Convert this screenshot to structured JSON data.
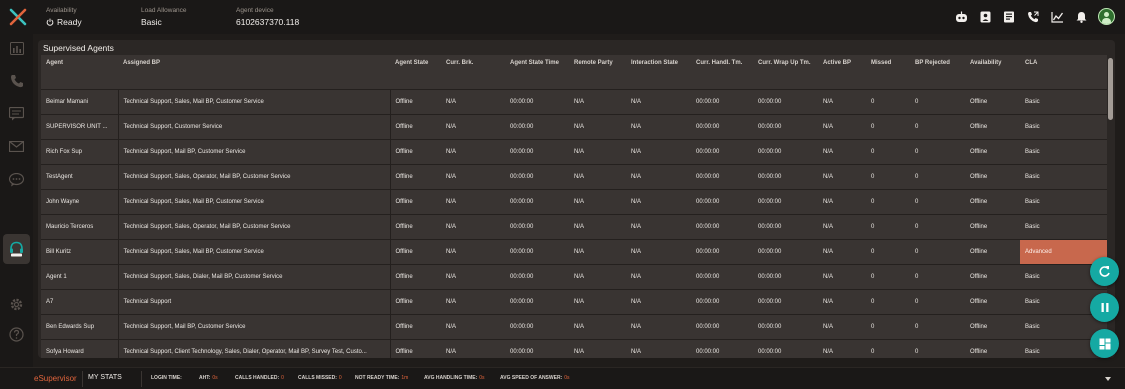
{
  "header": {
    "availability_label": "Availability",
    "availability_value": "Ready",
    "load_label": "Load Allowance",
    "load_value": "Basic",
    "device_label": "Agent device",
    "device_value": "6102637370.118"
  },
  "header_icons": [
    "bot-icon",
    "contact-card-icon",
    "address-book-icon",
    "phone-transfer-icon",
    "analytics-icon",
    "bell-icon",
    "avatar"
  ],
  "rail_icons": [
    "dashboard-icon",
    "phone-icon",
    "chat-icon",
    "email-icon",
    "message-bubble-icon",
    "supervisor-headset-icon",
    "settings-icon",
    "help-icon"
  ],
  "panel": {
    "title": "Supervised Agents",
    "columns": [
      "Agent",
      "Assigned BP",
      "Agent State",
      "Curr. Brk.",
      "Agent State Time",
      "Remote Party",
      "Interaction State",
      "Curr. Handl. Tm.",
      "Curr. Wrap Up Tm.",
      "Active BP",
      "Missed",
      "BP Rejected",
      "Availability",
      "CLA"
    ],
    "rows": [
      [
        "Beimar Mamani",
        "Technical Support, Sales, Mail BP, Customer Service",
        "Offline",
        "N/A",
        "00:00:00",
        "N/A",
        "N/A",
        "00:00:00",
        "00:00:00",
        "N/A",
        "0",
        "0",
        "Offline",
        "Basic"
      ],
      [
        "SUPERVISOR UNIT ...",
        "Technical Support, Customer Service",
        "Offline",
        "N/A",
        "00:00:00",
        "N/A",
        "N/A",
        "00:00:00",
        "00:00:00",
        "N/A",
        "0",
        "0",
        "Offline",
        "Basic"
      ],
      [
        "Rich Fox Sup",
        "Technical Support, Mail BP, Customer Service",
        "Offline",
        "N/A",
        "00:00:00",
        "N/A",
        "N/A",
        "00:00:00",
        "00:00:00",
        "N/A",
        "0",
        "0",
        "Offline",
        "Basic"
      ],
      [
        "TestAgent",
        "Technical Support, Sales, Operator, Mail BP, Customer Service",
        "Offline",
        "N/A",
        "00:00:00",
        "N/A",
        "N/A",
        "00:00:00",
        "00:00:00",
        "N/A",
        "0",
        "0",
        "Offline",
        "Basic"
      ],
      [
        "John Wayne",
        "Technical Support, Sales, Mail BP, Customer Service",
        "Offline",
        "N/A",
        "00:00:00",
        "N/A",
        "N/A",
        "00:00:00",
        "00:00:00",
        "N/A",
        "0",
        "0",
        "Offline",
        "Basic"
      ],
      [
        "Mauricio Terceros",
        "Technical Support, Sales, Operator, Mail BP, Customer Service",
        "Offline",
        "N/A",
        "00:00:00",
        "N/A",
        "N/A",
        "00:00:00",
        "00:00:00",
        "N/A",
        "0",
        "0",
        "Offline",
        "Basic"
      ],
      [
        "Bill Kuritz",
        "Technical Support, Sales, Mail BP, Customer Service",
        "Offline",
        "N/A",
        "00:00:00",
        "N/A",
        "N/A",
        "00:00:00",
        "00:00:00",
        "N/A",
        "0",
        "0",
        "Offline",
        "Advanced"
      ],
      [
        "Agent 1",
        "Technical Support, Sales, Dialer, Mail BP, Customer Service",
        "Offline",
        "N/A",
        "00:00:00",
        "N/A",
        "N/A",
        "00:00:00",
        "00:00:00",
        "N/A",
        "0",
        "0",
        "Offline",
        "Basic"
      ],
      [
        "A7",
        "Technical Support",
        "Offline",
        "N/A",
        "00:00:00",
        "N/A",
        "N/A",
        "00:00:00",
        "00:00:00",
        "N/A",
        "0",
        "0",
        "Offline",
        "Basic"
      ],
      [
        "Ben Edwards Sup",
        "Technical Support, Mail BP, Customer Service",
        "Offline",
        "N/A",
        "00:00:00",
        "N/A",
        "N/A",
        "00:00:00",
        "00:00:00",
        "N/A",
        "0",
        "0",
        "Offline",
        "Basic"
      ],
      [
        "Sofya Howard",
        "Technical Support, Client Technology, Sales, Dialer, Operator, Mail BP, Survey Test, Custo...",
        "Offline",
        "N/A",
        "00:00:00",
        "N/A",
        "N/A",
        "00:00:00",
        "00:00:00",
        "N/A",
        "0",
        "0",
        "Offline",
        "Basic"
      ]
    ]
  },
  "fabs": [
    "refresh-icon",
    "pause-icon",
    "layout-icon"
  ],
  "bottom": {
    "brand": "eSupervisor",
    "my_stats": "MY STATS",
    "stats": [
      {
        "label": "LOGIN TIME:",
        "value": ""
      },
      {
        "label": "AHT:",
        "value": "0s"
      },
      {
        "label": "CALLS HANDLED:",
        "value": "0"
      },
      {
        "label": "CALLS MISSED:",
        "value": "0"
      },
      {
        "label": "NOT READY TIME:",
        "value": "1m"
      },
      {
        "label": "AVG HANDLING TIME:",
        "value": "0s"
      },
      {
        "label": "AVG SPEED OF ANSWER:",
        "value": "0s"
      }
    ]
  },
  "colors": {
    "accent": "#15a9a3",
    "brand_orange": "#e0643c",
    "advanced_highlight": "#c8684d",
    "panel_bg": "#2b2725",
    "row_bg": "#393432"
  }
}
